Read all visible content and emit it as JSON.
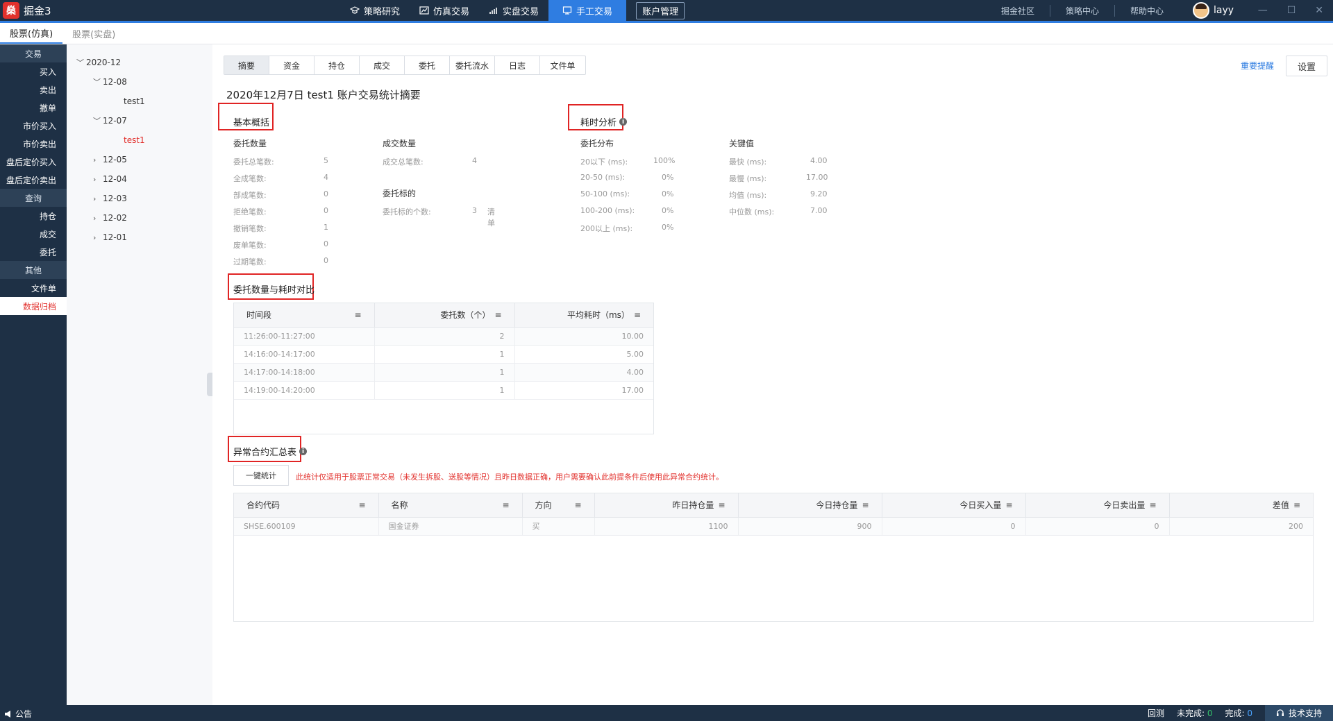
{
  "app": {
    "logo_char": "燊",
    "name": "掘金3"
  },
  "nav": [
    {
      "label": "策略研究",
      "icon": "graduation-cap-icon"
    },
    {
      "label": "仿真交易",
      "icon": "line-chart-icon"
    },
    {
      "label": "实盘交易",
      "icon": "bar-chart-icon"
    },
    {
      "label": "手工交易",
      "icon": "manual-trade-icon"
    },
    {
      "label": "账户管理",
      "icon": ""
    }
  ],
  "top_links": [
    "掘金社区",
    "策略中心",
    "帮助中心"
  ],
  "user": {
    "name": "layy"
  },
  "window_controls": {
    "minimize": "—",
    "maximize": "☐",
    "close": "✕"
  },
  "sub_tabs": [
    "股票(仿真)",
    "股票(实盘)"
  ],
  "sidebar": {
    "trade_group": "交易",
    "trade_items": [
      "买入",
      "卖出",
      "撤单",
      "市价买入",
      "市价卖出",
      "盘后定价买入",
      "盘后定价卖出"
    ],
    "query_group": "查询",
    "query_items": [
      "持仓",
      "成交",
      "委托"
    ],
    "other_group": "其他",
    "other_items": [
      "文件单",
      "数据归档"
    ]
  },
  "tree": {
    "month": "2020-12",
    "d1": "12-08",
    "d1_leaf": "test1",
    "d2": "12-07",
    "d2_leaf": "test1",
    "d3": "12-05",
    "d4": "12-04",
    "d5": "12-03",
    "d6": "12-02",
    "d7": "12-01"
  },
  "tabs": [
    "摘要",
    "资金",
    "持仓",
    "成交",
    "委托",
    "委托流水",
    "日志",
    "文件单"
  ],
  "alert_link": "重要提醒",
  "settings_btn": "设置",
  "page_title": "2020年12月7日 test1 账户交易统计摘要",
  "overview": {
    "title": "基本概括",
    "order_count_head": "委托数量",
    "order_rows": [
      {
        "k": "委托总笔数:",
        "v": "5"
      },
      {
        "k": "全成笔数:",
        "v": "4"
      },
      {
        "k": "部成笔数:",
        "v": "0"
      },
      {
        "k": "拒绝笔数:",
        "v": "0"
      },
      {
        "k": "撤销笔数:",
        "v": "1"
      },
      {
        "k": "废单笔数:",
        "v": "0"
      },
      {
        "k": "过期笔数:",
        "v": "0"
      }
    ],
    "deal_head": "成交数量",
    "deal_total_k": "成交总笔数:",
    "deal_total_v": "4",
    "target_head": "委托标的",
    "target_k": "委托标的个数:",
    "target_v": "3",
    "target_link": "清单"
  },
  "latency": {
    "title": "耗时分析",
    "dist_head": "委托分布",
    "dist_rows": [
      {
        "k": "20以下 (ms):",
        "v": "100%"
      },
      {
        "k": "20-50 (ms):",
        "v": "0%"
      },
      {
        "k": "50-100 (ms):",
        "v": "0%"
      },
      {
        "k": "100-200 (ms):",
        "v": "0%"
      },
      {
        "k": "200以上 (ms):",
        "v": "0%"
      }
    ],
    "key_head": "关键值",
    "key_rows": [
      {
        "k": "最快 (ms):",
        "v": "4.00"
      },
      {
        "k": "最慢 (ms):",
        "v": "17.00"
      },
      {
        "k": "均值 (ms):",
        "v": "9.20"
      },
      {
        "k": "中位数 (ms):",
        "v": "7.00"
      }
    ]
  },
  "compare": {
    "title": "委托数量与耗时对比",
    "headers": [
      "时间段",
      "委托数（个）",
      "平均耗时（ms）"
    ],
    "rows": [
      [
        "11:26:00-11:27:00",
        "2",
        "10.00"
      ],
      [
        "14:16:00-14:17:00",
        "1",
        "5.00"
      ],
      [
        "14:17:00-14:18:00",
        "1",
        "4.00"
      ],
      [
        "14:19:00-14:20:00",
        "1",
        "17.00"
      ]
    ]
  },
  "abnormal": {
    "title": "异常合约汇总表",
    "button": "一键统计",
    "warning": "此统计仅适用于股票正常交易（未发生拆股、送股等情况）且昨日数据正确，用户需要确认此前提条件后使用此异常合约统计。",
    "headers": [
      "合约代码",
      "名称",
      "方向",
      "昨日持仓量",
      "今日持仓量",
      "今日买入量",
      "今日卖出量",
      "差值"
    ],
    "rows": [
      [
        "SHSE.600109",
        "国金证券",
        "买",
        "1100",
        "900",
        "0",
        "0",
        "200"
      ]
    ]
  },
  "status": {
    "notice": "公告",
    "backtest": "回测",
    "unfinished_label": "未完成:",
    "unfinished_val": "0",
    "finished_label": "完成:",
    "finished_val": "0",
    "support": "技术支持"
  },
  "colors": {
    "accent": "#2f7de1",
    "dark": "#1e3045",
    "danger": "#e02424",
    "green": "#35c26b"
  }
}
